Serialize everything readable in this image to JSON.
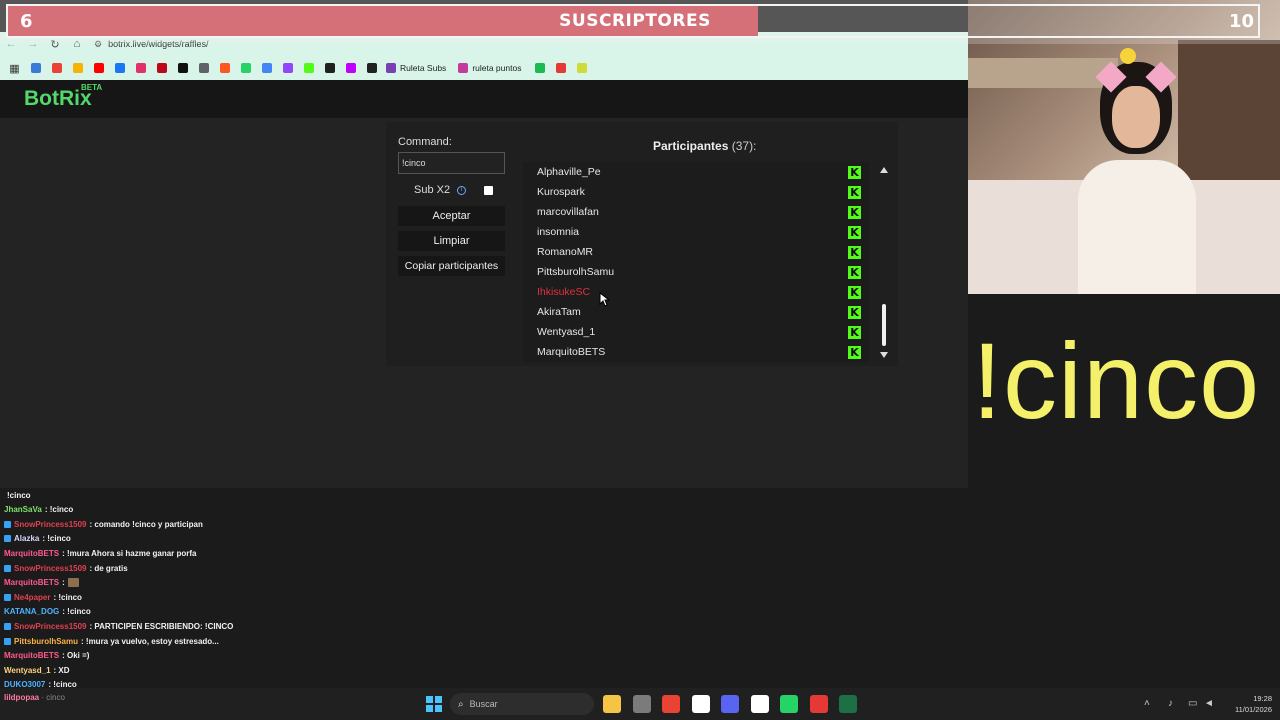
{
  "subs_overlay": {
    "current": "6",
    "goal": "10",
    "label": "SUSCRIPTORES",
    "fill_fraction": 0.6
  },
  "browser": {
    "url": "botrix.live/widgets/raffles/",
    "bookmarks": [
      {
        "label": "Ruleta Subs",
        "color": "#7a3fb0"
      },
      {
        "label": "ruleta puntos",
        "color": "#c33c9b"
      }
    ],
    "bookmark_icons": [
      "#3a7bd5",
      "#ea4335",
      "#f4b400",
      "#ff0000",
      "#1877f2",
      "#e1306c",
      "#bd081c",
      "#111111",
      "#5f6368",
      "#ff5722",
      "#25d366",
      "#4285f4",
      "#9146ff",
      "#53fc18",
      "#202020",
      "#bf00ff",
      "#222222",
      "#1db954",
      "#e53935",
      "#cddc39"
    ]
  },
  "site": {
    "logo": "BotRix",
    "logo_tag": "BETA"
  },
  "raffle": {
    "command_label": "Command:",
    "command_value": "!cinco",
    "sub_x2_label": "Sub X2",
    "accept_label": "Aceptar",
    "clear_label": "Limpiar",
    "copy_label": "Copiar participantes",
    "participants_title": "Participantes",
    "participants_count": "(37):",
    "participants": [
      {
        "name": "Alphaville_Pe",
        "highlight": false
      },
      {
        "name": "Kurospark",
        "highlight": false
      },
      {
        "name": "marcovillafan",
        "highlight": false
      },
      {
        "name": "insomnia",
        "highlight": false
      },
      {
        "name": "RomanoMR",
        "highlight": false
      },
      {
        "name": "PittsburolhSamu",
        "highlight": false
      },
      {
        "name": "IhkisukeSC",
        "highlight": true
      },
      {
        "name": "AkiraTam",
        "highlight": false
      },
      {
        "name": "Wentyasd_1",
        "highlight": false
      },
      {
        "name": "MarquitoBETS",
        "highlight": false
      }
    ],
    "platform_badge": "K"
  },
  "big_command": "!cinco",
  "chat": [
    {
      "user": "",
      "text": "!cinco",
      "color": "#d33a6a",
      "badge": false
    },
    {
      "user": "JhanSaVa",
      "text": ": !cinco",
      "color": "#7fe06a",
      "badge": false
    },
    {
      "user": "SnowPrincess1509",
      "text": ": comando !cinco y participan",
      "color": "#e0404f",
      "badge": true
    },
    {
      "user": "Alazka",
      "text": ": !cinco",
      "color": "#d6d6ff",
      "badge": true
    },
    {
      "user": "MarquitoBETS",
      "text": ": !mura Ahora si hazme ganar porfa",
      "color": "#ff5a8c",
      "badge": false
    },
    {
      "user": "SnowPrincess1509",
      "text": ": de gratis",
      "color": "#e0404f",
      "badge": true
    },
    {
      "user": "MarquitoBETS",
      "text": ":",
      "color": "#ff5a8c",
      "badge": false,
      "emote": true
    },
    {
      "user": "Ne4paper",
      "text": ": !cinco",
      "color": "#e0404f",
      "badge": true
    },
    {
      "user": "KATANA_DOG",
      "text": ": !cinco",
      "color": "#4fb3ff",
      "badge": false
    },
    {
      "user": "SnowPrincess1509",
      "text": ": PARTICIPEN ESCRIBIENDO: !CINCO",
      "color": "#e0404f",
      "badge": true
    },
    {
      "user": "PittsburolhSamu",
      "text": ": !mura ya vuelvo, estoy estresado...",
      "color": "#ffb347",
      "badge": true
    },
    {
      "user": "MarquitoBETS",
      "text": ": Oki =)",
      "color": "#ff5a8c",
      "badge": false
    },
    {
      "user": "Wentyasd_1",
      "text": ": XD",
      "color": "#ffd27f",
      "badge": false
    },
    {
      "user": "DUKO3007",
      "text": ": !cinco",
      "color": "#4fb3ff",
      "badge": false
    }
  ],
  "chat_footer_user": "lildpopaa",
  "chat_footer_text": "· cinco",
  "taskbar": {
    "search_placeholder": "Buscar",
    "time": "19:28",
    "date": "11/01/2026",
    "apps": [
      "#f6c445",
      "#7b7b7b",
      "#ea4335",
      "#ffffff",
      "#5865f2",
      "#ffffff",
      "#25d366",
      "#e53935",
      "#1d7044"
    ]
  }
}
